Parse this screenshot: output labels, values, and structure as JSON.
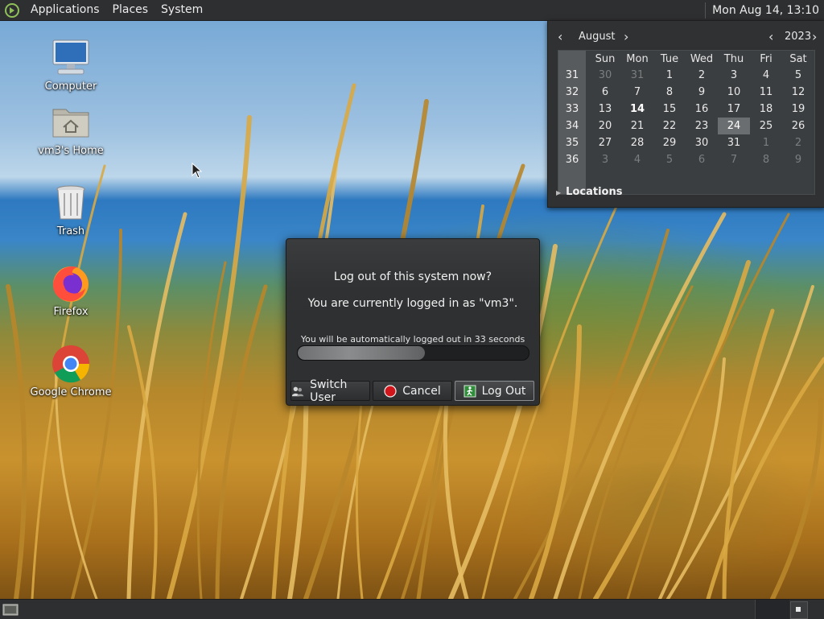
{
  "top_panel": {
    "menus": [
      "Applications",
      "Places",
      "System"
    ],
    "clock": "Mon Aug 14, 13:10"
  },
  "desktop_icons": [
    {
      "label": "Computer",
      "icon": "computer-icon"
    },
    {
      "label": "vm3's Home",
      "icon": "home-folder-icon"
    },
    {
      "label": "Trash",
      "icon": "trash-icon"
    },
    {
      "label": "Firefox",
      "icon": "firefox-icon"
    },
    {
      "label": "Google Chrome",
      "icon": "chrome-icon"
    }
  ],
  "calendar": {
    "month": "August",
    "year": "2023",
    "day_names": [
      "Sun",
      "Mon",
      "Tue",
      "Wed",
      "Thu",
      "Fri",
      "Sat"
    ],
    "weeks": [
      {
        "num": "31",
        "days": [
          "30",
          "31",
          "1",
          "2",
          "3",
          "4",
          "5"
        ],
        "other": [
          true,
          true,
          false,
          false,
          false,
          false,
          false
        ]
      },
      {
        "num": "32",
        "days": [
          "6",
          "7",
          "8",
          "9",
          "10",
          "11",
          "12"
        ],
        "other": [
          false,
          false,
          false,
          false,
          false,
          false,
          false
        ]
      },
      {
        "num": "33",
        "days": [
          "13",
          "14",
          "15",
          "16",
          "17",
          "18",
          "19"
        ],
        "other": [
          false,
          false,
          false,
          false,
          false,
          false,
          false
        ]
      },
      {
        "num": "34",
        "days": [
          "20",
          "21",
          "22",
          "23",
          "24",
          "25",
          "26"
        ],
        "other": [
          false,
          false,
          false,
          false,
          false,
          false,
          false
        ]
      },
      {
        "num": "35",
        "days": [
          "27",
          "28",
          "29",
          "30",
          "31",
          "1",
          "2"
        ],
        "other": [
          false,
          false,
          false,
          false,
          false,
          true,
          true
        ]
      },
      {
        "num": "36",
        "days": [
          "3",
          "4",
          "5",
          "6",
          "7",
          "8",
          "9"
        ],
        "other": [
          true,
          true,
          true,
          true,
          true,
          true,
          true
        ]
      }
    ],
    "today": "14",
    "selected": "24",
    "locations_label": "Locations"
  },
  "logout_dialog": {
    "title": "Log out of this system now?",
    "user_text": "You are currently logged in as \"vm3\".",
    "countdown_text": "You will be automatically logged out in 33 seconds",
    "progress": 0.55,
    "buttons": {
      "switch_user": "Switch User",
      "cancel": "Cancel",
      "log_out": "Log Out"
    }
  },
  "colors": {
    "panel": "#2e2f31",
    "dialog": "#2f3133",
    "cancel_red": "#d0161b",
    "logout_green": "#2f8c3a"
  }
}
